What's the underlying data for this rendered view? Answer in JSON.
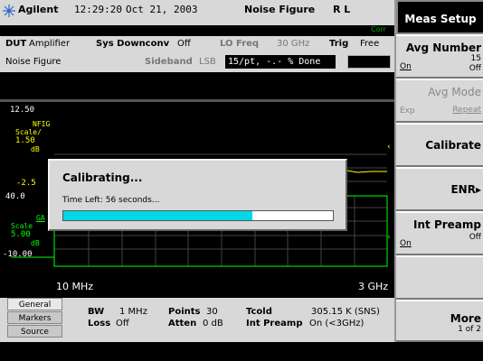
{
  "header": {
    "brand": "Agilent",
    "time": "12:29:20",
    "date": "Oct 21, 2003",
    "mode": "Noise Figure",
    "rl": "R L",
    "corr": "Corr"
  },
  "info": {
    "dut_label": "DUT",
    "dut_value": "Amplifier",
    "sys_label": "Sys Downconv",
    "sys_value": "Off",
    "lo_label": "LO Freq",
    "lo_value": "30 GHz",
    "trig_label": "Trig",
    "trig_value": "Free",
    "measurement": "Noise Figure",
    "sideband_label": "Sideband",
    "sideband_value": "LSB",
    "progress_text": "15/pt, -.- % Done"
  },
  "graph": {
    "top_ref": "12.50",
    "trace1_name": "NFIG",
    "trace1_scale_label": "Scale/",
    "trace1_scale_value": "1.50",
    "trace1_unit": "dB",
    "trace1_bottom": "-2.5",
    "trace2_top": "40.0",
    "trace2_name": "GA",
    "trace2_scale_label": "Scale",
    "trace2_scale_value": "5.00",
    "trace2_unit": "dB",
    "bottom_ref": "-10.00",
    "start_freq": "10 MHz",
    "stop_freq": "3 GHz",
    "trace1_color": "#ffff00",
    "trace2_color": "#00ff00"
  },
  "dialog": {
    "title": "Calibrating...",
    "message": "Time Left: 56 seconds...",
    "progress_fraction": 0.7
  },
  "tabs": [
    "General",
    "Markers",
    "Source"
  ],
  "bottom": {
    "bw_label": "BW",
    "bw_value": "1 MHz",
    "points_label": "Points",
    "points_value": "30",
    "tcold_label": "Tcold",
    "tcold_value": "305.15 K (SNS)",
    "loss_label": "Loss",
    "loss_value": "Off",
    "atten_label": "Atten",
    "atten_value": "0 dB",
    "preamp_label": "Int Preamp",
    "preamp_value": "On (<3GHz)"
  },
  "softkeys": {
    "title": "Meas Setup",
    "avg_number": {
      "label": "Avg Number",
      "value": "15",
      "left": "On",
      "right": "Off"
    },
    "avg_mode": {
      "label": "Avg Mode",
      "left": "Exp",
      "right": "Repeat"
    },
    "calibrate": {
      "label": "Calibrate"
    },
    "enr": {
      "label": "ENR▸"
    },
    "int_preamp": {
      "label": "Int Preamp",
      "left": "On",
      "right": "Off"
    },
    "more": {
      "label": "More",
      "sub": "1 of 2"
    }
  }
}
